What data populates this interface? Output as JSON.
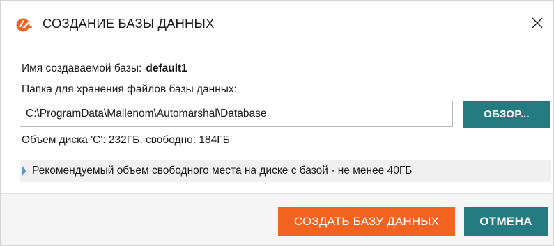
{
  "window": {
    "title": "СОЗДАНИЕ БАЗЫ ДАННЫХ",
    "app_icon": "automarshal-logo-icon",
    "close_icon": "close-icon"
  },
  "form": {
    "db_name_label": "Имя создаваемой базы:",
    "db_name_value": "default1",
    "folder_label": "Папка для хранения файлов базы данных:",
    "folder_path": "C:\\ProgramData\\Mallenom\\Automarshal\\Database",
    "browse_label": "ОБЗОР...",
    "disk_info": "Объем диска 'C': 232ГБ, свободно: 184ГБ",
    "hint": "Рекомендуемый объем свободного места на диске с базой - не менее 40ГБ"
  },
  "footer": {
    "create_label": "СОЗДАТЬ БАЗУ ДАННЫХ",
    "cancel_label": "ОТМЕНА"
  },
  "colors": {
    "accent_orange": "#f26322",
    "accent_teal": "#247b80",
    "hint_marker": "#5b9bd5"
  }
}
